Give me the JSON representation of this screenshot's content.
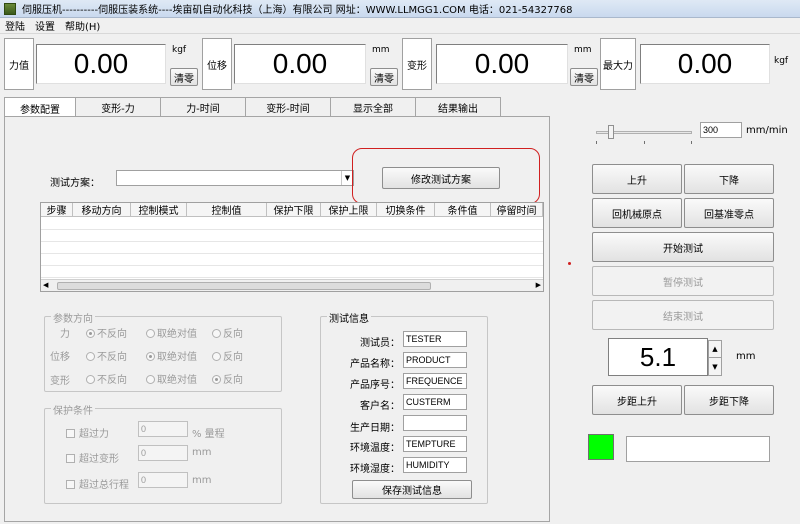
{
  "window": {
    "title": "伺服压机----------伺服压装系统----埃亩矶自动化科技（上海）有限公司 网址：WWW.LLMGG1.COM 电话：021-54327768"
  },
  "menu": [
    "登陆",
    "设置",
    "帮助(H)"
  ],
  "meters": {
    "force": {
      "label": "力值",
      "value": "0.00",
      "unit": "kgf",
      "zero_label": "清零"
    },
    "displacement": {
      "label": "位移",
      "value": "0.00",
      "unit": "mm",
      "zero_label": "清零"
    },
    "deform": {
      "label": "变形",
      "value": "0.00",
      "unit": "mm",
      "zero_label": "清零"
    },
    "max_force": {
      "label": "最大力",
      "value": "0.00",
      "unit": "kgf"
    }
  },
  "tabs": [
    "参数配置",
    "变形-力",
    "力-时间",
    "变形-时间",
    "显示全部",
    "结果输出"
  ],
  "scheme": {
    "label": "测试方案：",
    "value": "",
    "modify_button": "修改测试方案"
  },
  "steps_table": {
    "columns": [
      "步骤",
      "移动方向",
      "控制模式",
      "控制值",
      "保护下限",
      "保护上限",
      "切换条件",
      "条件值",
      "停留时间"
    ],
    "rows": []
  },
  "param_direction": {
    "title": "参数方向",
    "rows": [
      {
        "label": "力",
        "options": [
          "不反向",
          "取绝对值",
          "反向"
        ],
        "selected": 0
      },
      {
        "label": "位移",
        "options": [
          "不反向",
          "取绝对值",
          "反向"
        ],
        "selected": 1
      },
      {
        "label": "变形",
        "options": [
          "不反向",
          "取绝对值",
          "反向"
        ],
        "selected": 2
      }
    ]
  },
  "protection": {
    "title": "保护条件",
    "rows": [
      {
        "label": "超过力",
        "value": "0",
        "unit": "% 量程"
      },
      {
        "label": "超过变形",
        "value": "0",
        "unit": "mm"
      },
      {
        "label": "超过总行程",
        "value": "0",
        "unit": "mm"
      }
    ]
  },
  "test_info": {
    "title": "测试信息",
    "fields": [
      {
        "label": "测试员：",
        "value": "TESTER"
      },
      {
        "label": "产品名称：",
        "value": "PRODUCT"
      },
      {
        "label": "产品序号：",
        "value": "FREQUENCE"
      },
      {
        "label": "客户名：",
        "value": "CUSTERM"
      },
      {
        "label": "生产日期：",
        "value": ""
      },
      {
        "label": "环境温度：",
        "value": "TEMPTURE"
      },
      {
        "label": "环境湿度：",
        "value": "HUMIDITY"
      }
    ],
    "save_button": "保存测试信息"
  },
  "control": {
    "speed_value": "300",
    "speed_unit": "mm/min",
    "speed_level": 0.13,
    "up": "上升",
    "down": "下降",
    "return_origin": "回机械原点",
    "return_zero": "回基准零点",
    "start": "开始测试",
    "pause": "暂停测试",
    "stop": "结束测试",
    "step_value": "5.1",
    "step_unit": "mm",
    "step_up": "步距上升",
    "step_down": "步距下降",
    "status_text": "",
    "status_color": "#00ff00"
  },
  "colors": {
    "highlight": "#d02020",
    "status": "#00ff00"
  }
}
